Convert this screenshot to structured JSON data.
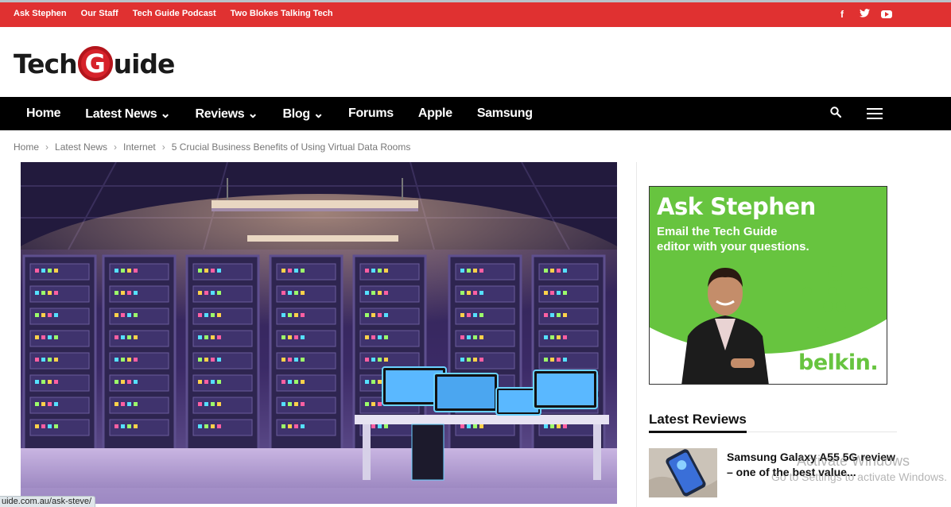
{
  "topbar": {
    "links": [
      "Ask Stephen",
      "Our Staff",
      "Tech Guide Podcast",
      "Two Blokes Talking Tech"
    ],
    "social_icons": [
      "facebook-icon",
      "twitter-icon",
      "youtube-icon"
    ],
    "facebook_glyph": "f"
  },
  "logo": {
    "part1": "Tech",
    "letter": "G",
    "part2": "uide"
  },
  "nav": {
    "items": [
      {
        "label": "Home",
        "has_dropdown": false
      },
      {
        "label": "Latest News",
        "has_dropdown": true
      },
      {
        "label": "Reviews",
        "has_dropdown": true
      },
      {
        "label": "Blog",
        "has_dropdown": true
      },
      {
        "label": "Forums",
        "has_dropdown": false
      },
      {
        "label": "Apple",
        "has_dropdown": false
      },
      {
        "label": "Samsung",
        "has_dropdown": false
      }
    ]
  },
  "breadcrumb": [
    "Home",
    "Latest News",
    "Internet",
    "5 Crucial Business Benefits of Using Virtual Data Rooms"
  ],
  "ad": {
    "heading": "Ask Stephen",
    "line1": "Email the Tech Guide",
    "line2": "editor with your questions.",
    "brand": "belkin."
  },
  "latest_reviews": {
    "title": "Latest Reviews",
    "items": [
      {
        "title": "Samsung Galaxy A55 5G review – one of the best value..."
      }
    ]
  },
  "watermark": {
    "line1": "Activate Windows",
    "line2": "Go to Settings to activate Windows."
  },
  "statusbar": {
    "url": "uide.com.au/ask-steve/"
  },
  "colors": {
    "topbar": "#e03131",
    "nav": "#000000",
    "brand_red": "#d6222a",
    "belkin_green": "#67c43f"
  }
}
